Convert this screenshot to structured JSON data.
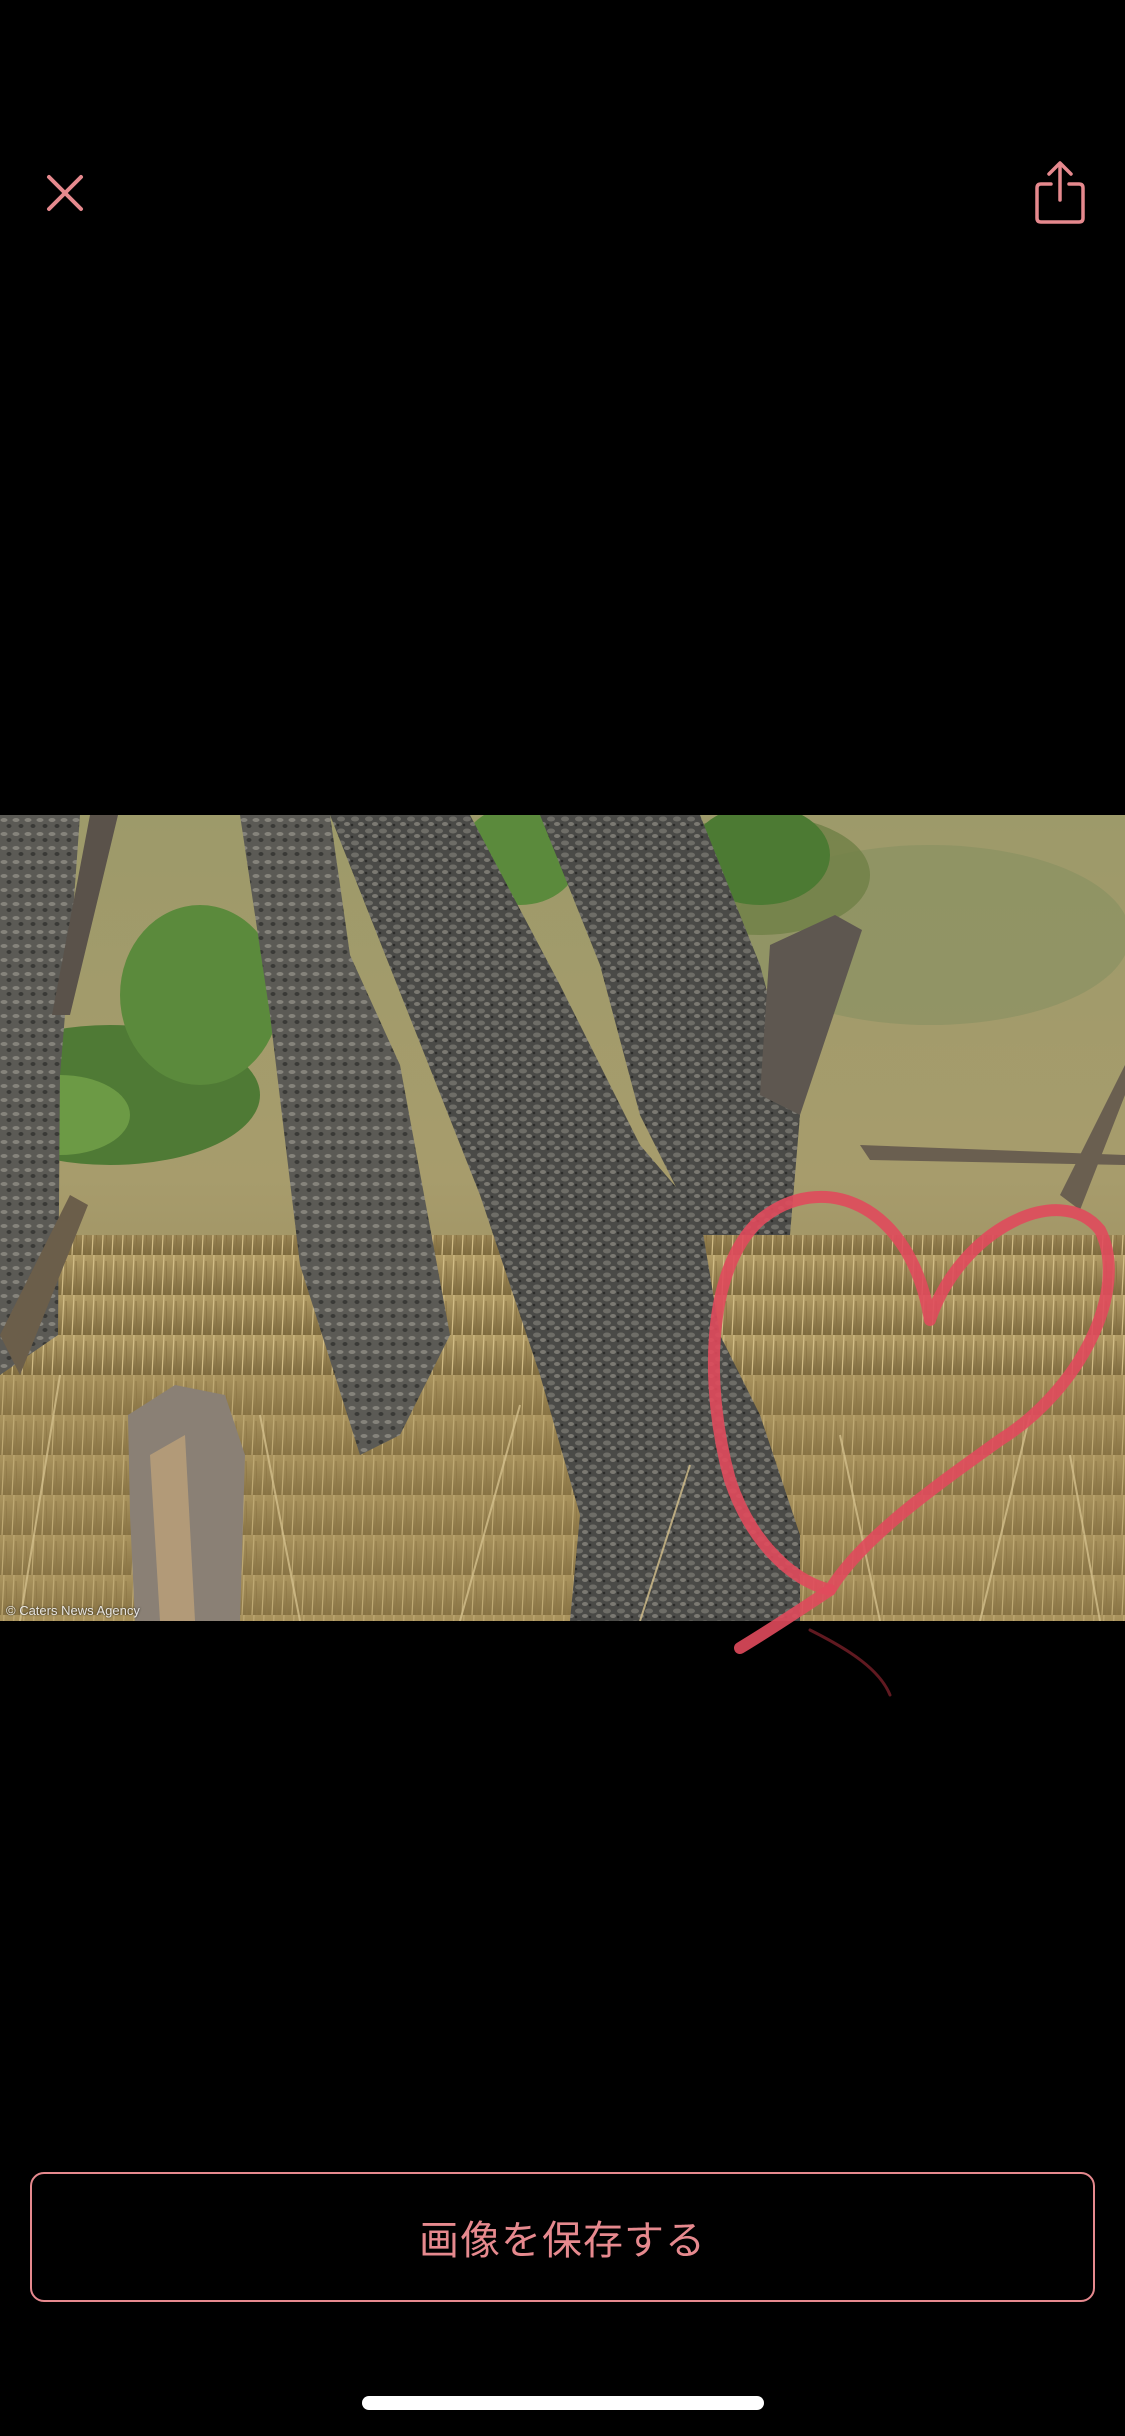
{
  "toolbar": {
    "close_icon": "close-icon",
    "share_icon": "share-icon",
    "accent_color": "#e6898e"
  },
  "photo": {
    "watermark": "© Caters News Agency",
    "annotation": "heart-doodle"
  },
  "actions": {
    "save_label": "画像を保存する"
  }
}
